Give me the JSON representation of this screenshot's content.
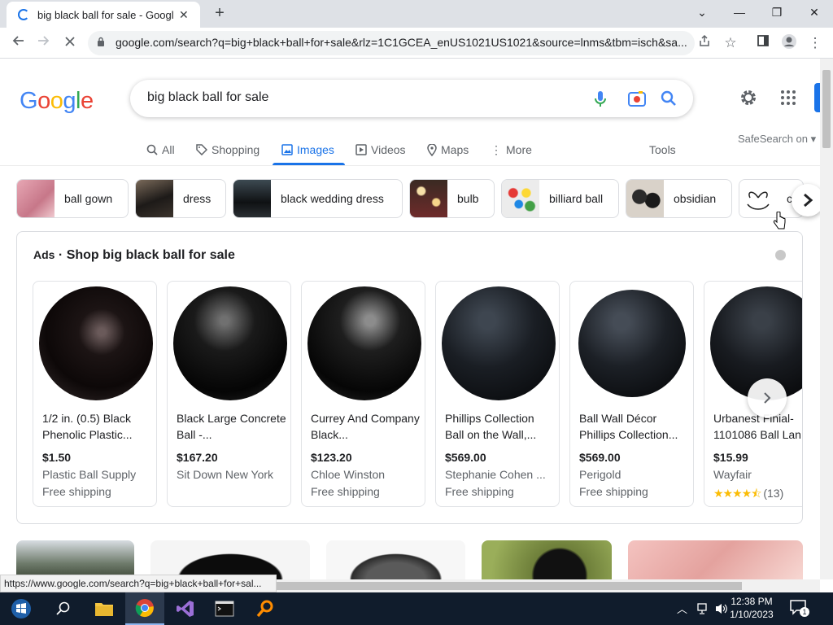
{
  "browser": {
    "tab_title": "big black ball for sale - Google S",
    "url": "google.com/search?q=big+black+ball+for+sale&rlz=1C1GCEA_enUS1021US1021&source=lnms&tbm=isch&sa...",
    "status_url": "https://www.google.com/search?q=big+black+ball+for+sal..."
  },
  "google": {
    "logo": "Google",
    "query": "big black ball for sale",
    "safesearch": "SafeSearch on",
    "tools_label": "Tools",
    "tabs": [
      {
        "label": "All",
        "icon": "search-icon"
      },
      {
        "label": "Shopping",
        "icon": "tag-icon"
      },
      {
        "label": "Images",
        "icon": "image-icon",
        "active": true
      },
      {
        "label": "Videos",
        "icon": "play-icon"
      },
      {
        "label": "Maps",
        "icon": "map-pin-icon"
      },
      {
        "label": "More",
        "icon": "dots-vertical-icon"
      }
    ],
    "chips": [
      "ball gown",
      "dress",
      "black wedding dress",
      "bulb",
      "billiard ball",
      "obsidian",
      "c"
    ],
    "ads_label": "Ads",
    "ads_heading": "Shop big black ball for sale",
    "products": [
      {
        "name": "1/2 in. (0.5) Black Phenolic Plastic...",
        "price": "$1.50",
        "store": "Plastic Ball Supply",
        "shipping": "Free shipping"
      },
      {
        "name": "Black Large Concrete Ball -...",
        "price": "$167.20",
        "store": "Sit Down New York",
        "shipping": ""
      },
      {
        "name": "Currey And Company Black...",
        "price": "$123.20",
        "store": "Chloe Winston",
        "shipping": "Free shipping"
      },
      {
        "name": "Phillips Collection Ball on the Wall,...",
        "price": "$569.00",
        "store": "Stephanie Cohen ...",
        "shipping": "Free shipping"
      },
      {
        "name": "Ball Wall Décor Phillips Collection...",
        "price": "$569.00",
        "store": "Perigold",
        "shipping": "Free shipping"
      },
      {
        "name": "Urbanest Finial-1101086 Ball Lan",
        "price": "$15.99",
        "store": "Wayfair",
        "rating_count": "(13)",
        "rating": 4.5
      }
    ]
  },
  "taskbar": {
    "time": "12:38 PM",
    "date": "1/10/2023",
    "notification_count": "1"
  },
  "colors": {
    "accent": "#1a73e8",
    "taskbar": "#101c2c"
  }
}
